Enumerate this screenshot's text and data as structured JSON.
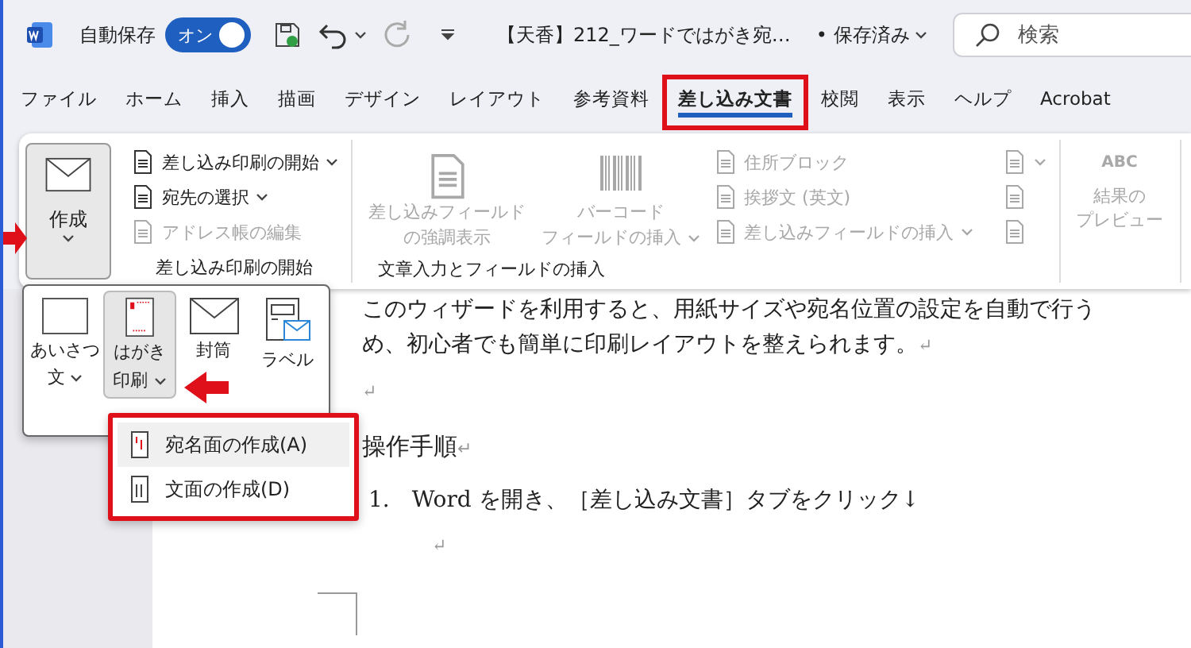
{
  "title_bar": {
    "autosave_label": "自動保存",
    "autosave_toggle": {
      "label": "オン",
      "on": true
    },
    "document_title": "【天香】212_ワードではがき宛…",
    "save_status": "• 保存済み",
    "search": {
      "placeholder": "検索"
    }
  },
  "tabs": [
    {
      "label": "ファイル",
      "selected": false,
      "highlighted": false
    },
    {
      "label": "ホーム",
      "selected": false,
      "highlighted": false
    },
    {
      "label": "挿入",
      "selected": false,
      "highlighted": false
    },
    {
      "label": "描画",
      "selected": false,
      "highlighted": false
    },
    {
      "label": "デザイン",
      "selected": false,
      "highlighted": false
    },
    {
      "label": "レイアウト",
      "selected": false,
      "highlighted": false
    },
    {
      "label": "参考資料",
      "selected": false,
      "highlighted": false
    },
    {
      "label": "差し込み文書",
      "selected": true,
      "highlighted": true
    },
    {
      "label": "校閲",
      "selected": false,
      "highlighted": false
    },
    {
      "label": "表示",
      "selected": false,
      "highlighted": false
    },
    {
      "label": "ヘルプ",
      "selected": false,
      "highlighted": false
    },
    {
      "label": "Acrobat",
      "selected": false,
      "highlighted": false
    }
  ],
  "ribbon": {
    "create_button": {
      "label": "作成",
      "pressed": true
    },
    "start_group": {
      "label": "差し込み印刷の開始",
      "items": [
        {
          "label": "差し込み印刷の開始",
          "dropdown": true,
          "disabled": false
        },
        {
          "label": "宛先の選択",
          "dropdown": true,
          "disabled": false
        },
        {
          "label": "アドレス帳の編集",
          "dropdown": false,
          "disabled": true
        }
      ]
    },
    "fields_group": {
      "label": "文章入力とフィールドの挿入",
      "large_buttons": [
        {
          "lines": [
            "差し込みフィールド",
            "の強調表示"
          ],
          "dropdown": false,
          "disabled": true
        },
        {
          "lines": [
            "バーコード",
            "フィールドの挿入"
          ],
          "dropdown": true,
          "disabled": true
        }
      ],
      "small_buttons": [
        {
          "label": "住所ブロック",
          "dropdown": false,
          "disabled": true
        },
        {
          "label": "挨拶文 (英文)",
          "dropdown": false,
          "disabled": true
        },
        {
          "label": "差し込みフィールドの挿入",
          "dropdown": true,
          "disabled": true
        }
      ],
      "icon_buttons": [
        {
          "dropdown": true,
          "disabled": true
        },
        {
          "dropdown": false,
          "disabled": true
        },
        {
          "dropdown": false,
          "disabled": true
        }
      ]
    },
    "preview_button": {
      "icon_text": "ABC",
      "lines": [
        "結果の",
        "プレビュー"
      ],
      "disabled": true
    }
  },
  "create_menu": {
    "items": [
      {
        "lines": [
          "あいさつ",
          "文"
        ],
        "dropdown": true,
        "selected": false
      },
      {
        "lines": [
          "はがき",
          "印刷"
        ],
        "dropdown": true,
        "selected": true
      },
      {
        "lines": [
          "封筒"
        ],
        "dropdown": false,
        "selected": false
      },
      {
        "lines": [
          "ラベル"
        ],
        "dropdown": false,
        "selected": false
      }
    ]
  },
  "callouts": [
    {
      "kind": "right_arrow"
    },
    {
      "kind": "left_arrow"
    }
  ],
  "postcard_menu": {
    "highlighted": true,
    "items": [
      {
        "label": "宛名面の作成(A)",
        "selected": true
      },
      {
        "label": "文面の作成(D)",
        "selected": false
      }
    ]
  },
  "document": {
    "paragraphs": [
      {
        "kind": "body",
        "text": "このウィザードを利用すると、用紙サイズや宛名位置の設定を自動で行う"
      },
      {
        "kind": "body",
        "text": "め、初心者でも簡単に印刷レイアウトを整えられます。",
        "mark": "↵"
      },
      {
        "kind": "empty",
        "mark": "↵"
      },
      {
        "kind": "heading",
        "text": "操作手順",
        "mark": "↵"
      },
      {
        "kind": "list",
        "number": "1.",
        "text": "Word を開き、［差し込み文書］タブをクリック↓"
      },
      {
        "kind": "empty",
        "mark": "↵"
      }
    ]
  }
}
